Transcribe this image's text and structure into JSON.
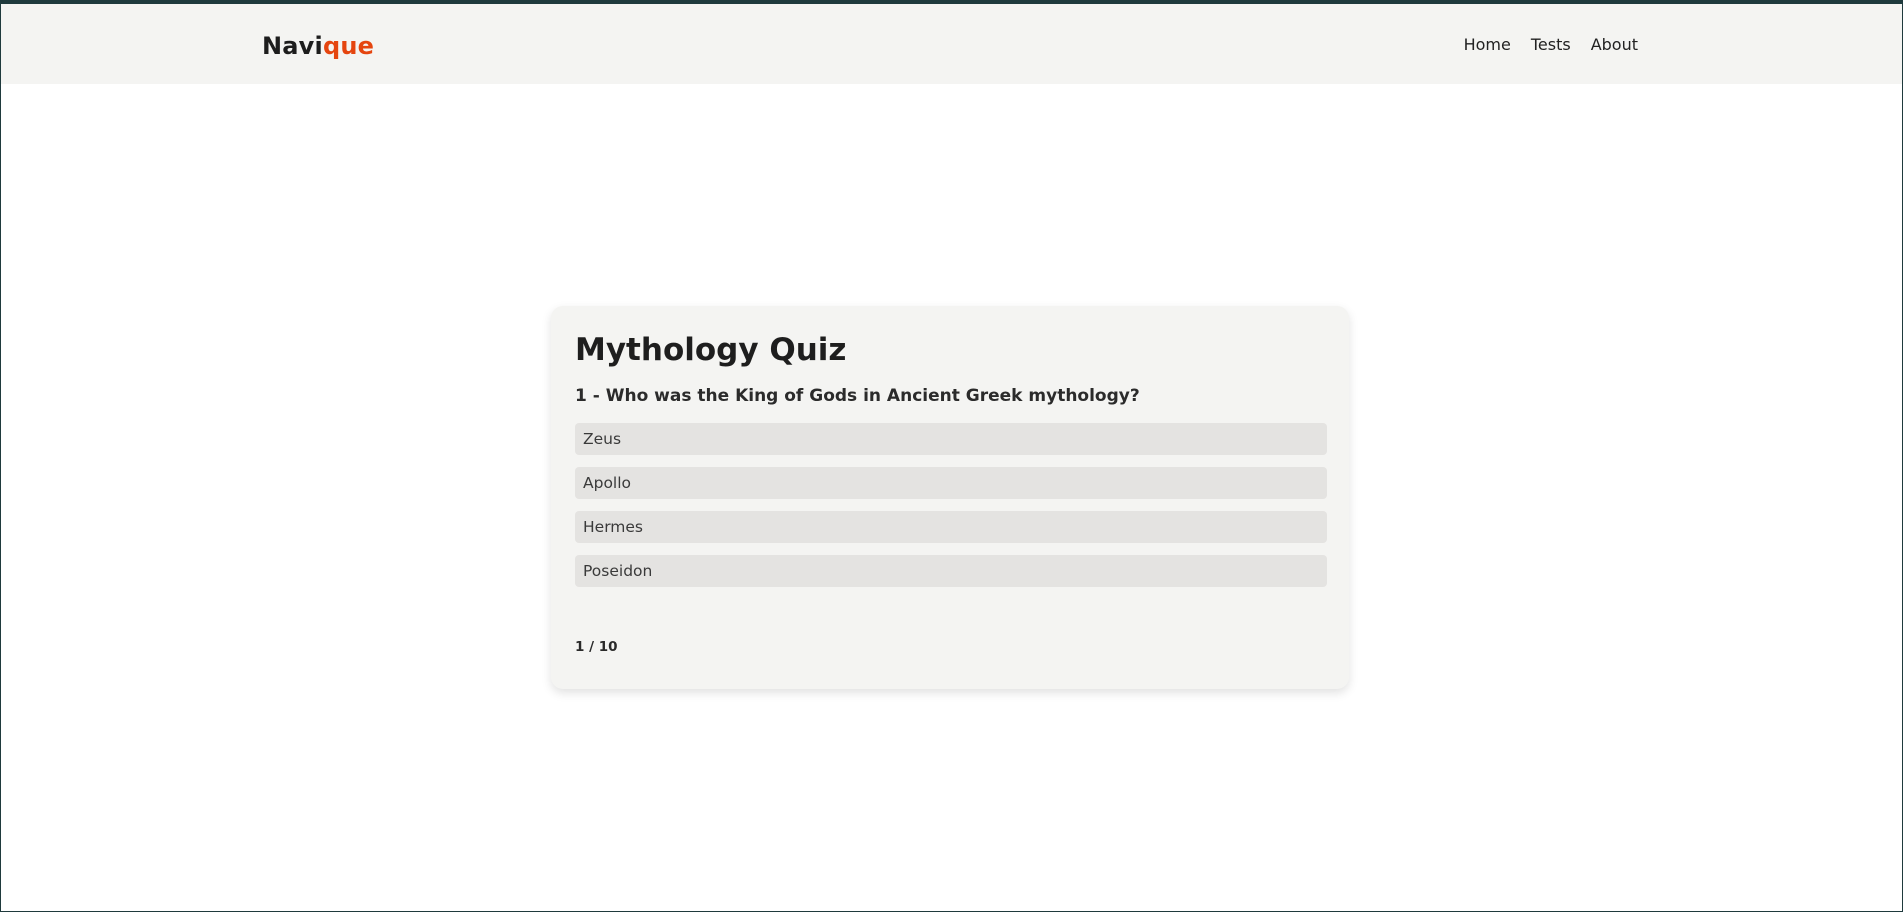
{
  "header": {
    "brand_part1": "Navi",
    "brand_part2": "que",
    "nav": [
      "Home",
      "Tests",
      "About"
    ]
  },
  "quiz": {
    "title": "Mythology Quiz",
    "question": "1 - Who was the King of Gods in Ancient Greek mythology?",
    "options": [
      "Zeus",
      "Apollo",
      "Hermes",
      "Poseidon"
    ],
    "progress": "1 / 10"
  },
  "colors": {
    "brand_accent": "#e5450f",
    "header_bg": "#f4f4f2",
    "card_bg": "#f4f4f2",
    "option_bg": "#e4e3e1",
    "frame": "#1f3a3d"
  }
}
